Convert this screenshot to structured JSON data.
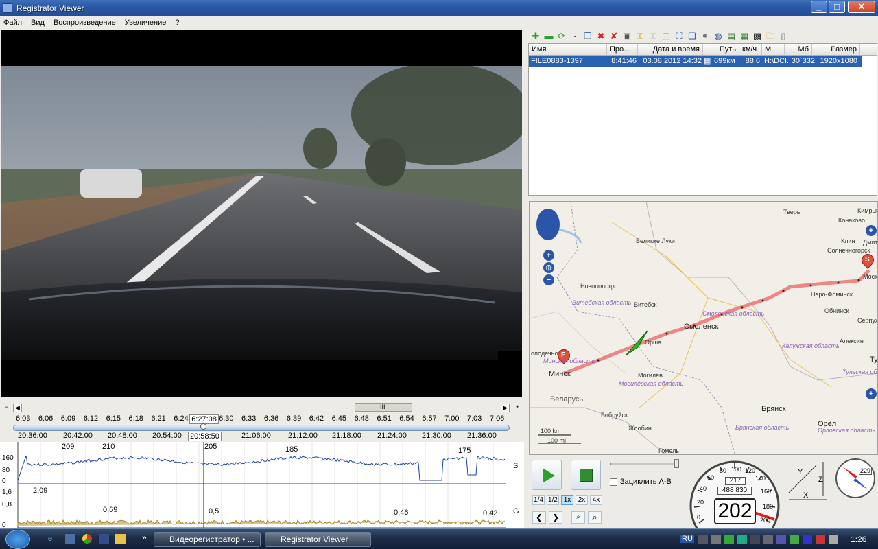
{
  "window": {
    "title": "Registrator Viewer",
    "min": "_",
    "max": "□",
    "close": "✕"
  },
  "menu": [
    "Файл",
    "Вид",
    "Воспроизведение",
    "Увеличение",
    "?"
  ],
  "file_table": {
    "columns": [
      "Имя",
      "Про...",
      "Дата и время",
      "Путь",
      "км/ч",
      "М...",
      "Мб",
      "Размер"
    ],
    "rows": [
      [
        "FILE0883-1397",
        "8:41:46",
        "03.08.2012 14:32",
        "699км",
        "88.6",
        "H:\\DCI..",
        "30`332",
        "1920x1080"
      ]
    ]
  },
  "timeline": {
    "top_ticks": [
      "6:03",
      "6:06",
      "6:09",
      "6:12",
      "6:15",
      "6:18",
      "6:21",
      "6:24",
      "6:27:08",
      "6:30",
      "6:33",
      "6:36",
      "6:39",
      "6:42",
      "6:45",
      "6:48",
      "6:51",
      "6:54",
      "6:57",
      "7:00",
      "7:03",
      "7:06"
    ],
    "bottom_ticks": [
      "20:36:00",
      "20:42:00",
      "20:48:00",
      "20:54:00",
      "20:58:50",
      "21:06:00",
      "21:12:00",
      "21:18:00",
      "21:24:00",
      "21:30:00",
      "21:36:00"
    ],
    "current_top": "6:27:08",
    "current_bottom": "20:58:50",
    "scroll_grip": "III",
    "zoom_out": "−",
    "zoom_in": "+"
  },
  "speed_chart": {
    "label": "S",
    "yticks": [
      "160",
      "80",
      "0"
    ],
    "peaks": [
      "209",
      "210",
      "205",
      "185",
      "175"
    ]
  },
  "g_chart": {
    "label": "G",
    "yticks": [
      "1,6",
      "0,8",
      "0"
    ],
    "peaks": [
      "2,09",
      "0,69",
      "0,5",
      "0,46",
      "0,42"
    ]
  },
  "map": {
    "cities": [
      "Смоленск",
      "Брянск",
      "Орёл",
      "Беларусь",
      "Минск",
      "Витебск",
      "Великие Луки",
      "Тверь",
      "Кимры",
      "Конаково",
      "Клин",
      "Дмитр",
      "Солнечногорск",
      "Наро-Фоминск",
      "Обнинск",
      "Серпух",
      "Алексин",
      "Тул",
      "Новополоцк",
      "Бобруйск",
      "Жлобин",
      "Гомель",
      "Орша",
      "Могилёв",
      "олодечно",
      "Москв"
    ],
    "regions": [
      "Витебская область",
      "Смоленская область",
      "Калужская область",
      "Минская область",
      "Могилёвская область",
      "Брянская область",
      "Орловская область",
      "Тульская обл"
    ],
    "scale": [
      "100 km",
      "100 mi"
    ],
    "markers": [
      "S",
      "F"
    ]
  },
  "player": {
    "loop_label": "Зациклить A-B",
    "speeds": [
      "1/4",
      "1/2",
      "1x",
      "2x",
      "4x"
    ],
    "active_speed": "1x"
  },
  "speedometer": {
    "speed": "202",
    "trip": "217",
    "odometer": "488 830",
    "marks": [
      "0",
      "20",
      "40",
      "60",
      "80",
      "100",
      "120",
      "140",
      "160",
      "180",
      "200"
    ]
  },
  "compass": {
    "value": "229"
  },
  "axes": {
    "x": "X",
    "y": "Y",
    "z": "Z"
  },
  "taskbar": {
    "tasks": [
      "Видеорегистратор • ...",
      "Registrator Viewer"
    ],
    "lang": "RU",
    "clock": "1:26",
    "chevron": "»"
  }
}
